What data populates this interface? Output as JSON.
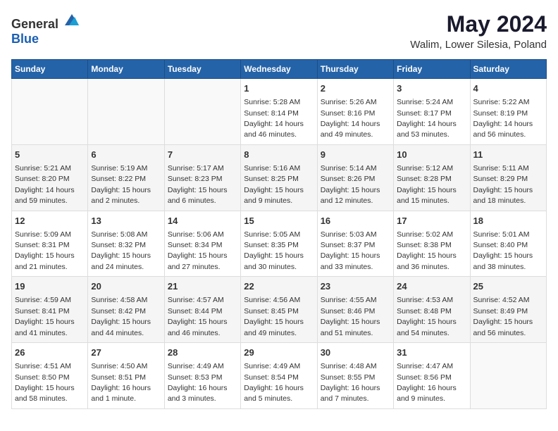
{
  "header": {
    "logo_general": "General",
    "logo_blue": "Blue",
    "month_title": "May 2024",
    "location": "Walim, Lower Silesia, Poland"
  },
  "days_of_week": [
    "Sunday",
    "Monday",
    "Tuesday",
    "Wednesday",
    "Thursday",
    "Friday",
    "Saturday"
  ],
  "weeks": [
    [
      {
        "day": "",
        "info": ""
      },
      {
        "day": "",
        "info": ""
      },
      {
        "day": "",
        "info": ""
      },
      {
        "day": "1",
        "info": "Sunrise: 5:28 AM\nSunset: 8:14 PM\nDaylight: 14 hours\nand 46 minutes."
      },
      {
        "day": "2",
        "info": "Sunrise: 5:26 AM\nSunset: 8:16 PM\nDaylight: 14 hours\nand 49 minutes."
      },
      {
        "day": "3",
        "info": "Sunrise: 5:24 AM\nSunset: 8:17 PM\nDaylight: 14 hours\nand 53 minutes."
      },
      {
        "day": "4",
        "info": "Sunrise: 5:22 AM\nSunset: 8:19 PM\nDaylight: 14 hours\nand 56 minutes."
      }
    ],
    [
      {
        "day": "5",
        "info": "Sunrise: 5:21 AM\nSunset: 8:20 PM\nDaylight: 14 hours\nand 59 minutes."
      },
      {
        "day": "6",
        "info": "Sunrise: 5:19 AM\nSunset: 8:22 PM\nDaylight: 15 hours\nand 2 minutes."
      },
      {
        "day": "7",
        "info": "Sunrise: 5:17 AM\nSunset: 8:23 PM\nDaylight: 15 hours\nand 6 minutes."
      },
      {
        "day": "8",
        "info": "Sunrise: 5:16 AM\nSunset: 8:25 PM\nDaylight: 15 hours\nand 9 minutes."
      },
      {
        "day": "9",
        "info": "Sunrise: 5:14 AM\nSunset: 8:26 PM\nDaylight: 15 hours\nand 12 minutes."
      },
      {
        "day": "10",
        "info": "Sunrise: 5:12 AM\nSunset: 8:28 PM\nDaylight: 15 hours\nand 15 minutes."
      },
      {
        "day": "11",
        "info": "Sunrise: 5:11 AM\nSunset: 8:29 PM\nDaylight: 15 hours\nand 18 minutes."
      }
    ],
    [
      {
        "day": "12",
        "info": "Sunrise: 5:09 AM\nSunset: 8:31 PM\nDaylight: 15 hours\nand 21 minutes."
      },
      {
        "day": "13",
        "info": "Sunrise: 5:08 AM\nSunset: 8:32 PM\nDaylight: 15 hours\nand 24 minutes."
      },
      {
        "day": "14",
        "info": "Sunrise: 5:06 AM\nSunset: 8:34 PM\nDaylight: 15 hours\nand 27 minutes."
      },
      {
        "day": "15",
        "info": "Sunrise: 5:05 AM\nSunset: 8:35 PM\nDaylight: 15 hours\nand 30 minutes."
      },
      {
        "day": "16",
        "info": "Sunrise: 5:03 AM\nSunset: 8:37 PM\nDaylight: 15 hours\nand 33 minutes."
      },
      {
        "day": "17",
        "info": "Sunrise: 5:02 AM\nSunset: 8:38 PM\nDaylight: 15 hours\nand 36 minutes."
      },
      {
        "day": "18",
        "info": "Sunrise: 5:01 AM\nSunset: 8:40 PM\nDaylight: 15 hours\nand 38 minutes."
      }
    ],
    [
      {
        "day": "19",
        "info": "Sunrise: 4:59 AM\nSunset: 8:41 PM\nDaylight: 15 hours\nand 41 minutes."
      },
      {
        "day": "20",
        "info": "Sunrise: 4:58 AM\nSunset: 8:42 PM\nDaylight: 15 hours\nand 44 minutes."
      },
      {
        "day": "21",
        "info": "Sunrise: 4:57 AM\nSunset: 8:44 PM\nDaylight: 15 hours\nand 46 minutes."
      },
      {
        "day": "22",
        "info": "Sunrise: 4:56 AM\nSunset: 8:45 PM\nDaylight: 15 hours\nand 49 minutes."
      },
      {
        "day": "23",
        "info": "Sunrise: 4:55 AM\nSunset: 8:46 PM\nDaylight: 15 hours\nand 51 minutes."
      },
      {
        "day": "24",
        "info": "Sunrise: 4:53 AM\nSunset: 8:48 PM\nDaylight: 15 hours\nand 54 minutes."
      },
      {
        "day": "25",
        "info": "Sunrise: 4:52 AM\nSunset: 8:49 PM\nDaylight: 15 hours\nand 56 minutes."
      }
    ],
    [
      {
        "day": "26",
        "info": "Sunrise: 4:51 AM\nSunset: 8:50 PM\nDaylight: 15 hours\nand 58 minutes."
      },
      {
        "day": "27",
        "info": "Sunrise: 4:50 AM\nSunset: 8:51 PM\nDaylight: 16 hours\nand 1 minute."
      },
      {
        "day": "28",
        "info": "Sunrise: 4:49 AM\nSunset: 8:53 PM\nDaylight: 16 hours\nand 3 minutes."
      },
      {
        "day": "29",
        "info": "Sunrise: 4:49 AM\nSunset: 8:54 PM\nDaylight: 16 hours\nand 5 minutes."
      },
      {
        "day": "30",
        "info": "Sunrise: 4:48 AM\nSunset: 8:55 PM\nDaylight: 16 hours\nand 7 minutes."
      },
      {
        "day": "31",
        "info": "Sunrise: 4:47 AM\nSunset: 8:56 PM\nDaylight: 16 hours\nand 9 minutes."
      },
      {
        "day": "",
        "info": ""
      }
    ]
  ]
}
